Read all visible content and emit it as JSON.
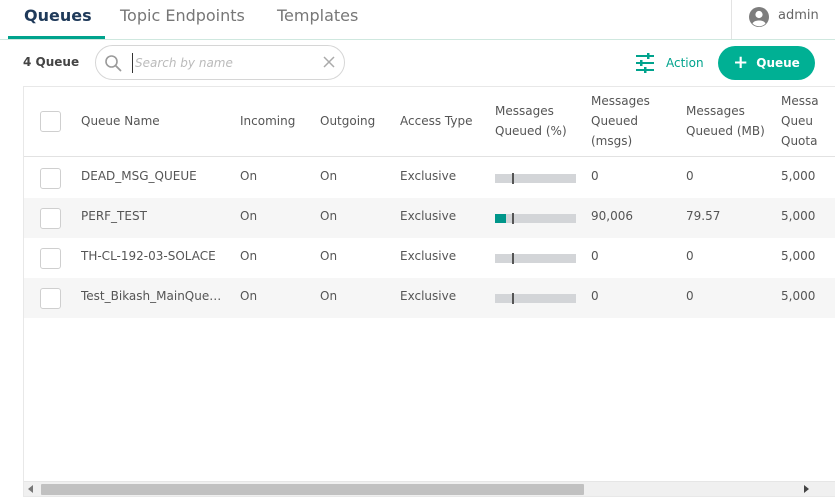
{
  "tabs": [
    {
      "label": "Queues",
      "active": true
    },
    {
      "label": "Topic Endpoints",
      "active": false
    },
    {
      "label": "Templates",
      "active": false
    }
  ],
  "user": {
    "name": "admin",
    "icon": "user-avatar-icon"
  },
  "toolbar": {
    "count_label": "4 Queue",
    "search_placeholder": "Search by name",
    "search_value": "",
    "action_label": "Action",
    "add_label": "Queue"
  },
  "colors": {
    "accent": "#00b094",
    "accent_dark": "#00968a",
    "tab_active_text": "#1f3a5a"
  },
  "table": {
    "columns": [
      {
        "line1": "Queue Name",
        "line2": "",
        "line3": ""
      },
      {
        "line1": "Incoming",
        "line2": "",
        "line3": ""
      },
      {
        "line1": "Outgoing",
        "line2": "",
        "line3": ""
      },
      {
        "line1": "Access Type",
        "line2": "",
        "line3": ""
      },
      {
        "line1": "Messages",
        "line2": "Queued (%)",
        "line3": ""
      },
      {
        "line1": "Messages",
        "line2": "Queued",
        "line3": "(msgs)"
      },
      {
        "line1": "Messages",
        "line2": "Queued (MB)",
        "line3": ""
      },
      {
        "line1": "Messa",
        "line2": "Queu",
        "line3": "Quota"
      }
    ],
    "rows": [
      {
        "name": "DEAD_MSG_QUEUE",
        "incoming": "On",
        "outgoing": "On",
        "access": "Exclusive",
        "queued_pct": 0,
        "queued_msgs": "0",
        "queued_mb": "0",
        "quota": "5,000"
      },
      {
        "name": "PERF_TEST",
        "incoming": "On",
        "outgoing": "On",
        "access": "Exclusive",
        "queued_pct": 0.14,
        "queued_msgs": "90,006",
        "queued_mb": "79.57",
        "quota": "5,000"
      },
      {
        "name": "TH-CL-192-03-SOLACE",
        "incoming": "On",
        "outgoing": "On",
        "access": "Exclusive",
        "queued_pct": 0,
        "queued_msgs": "0",
        "queued_mb": "0",
        "quota": "5,000"
      },
      {
        "name": "Test_Bikash_MainQue…",
        "incoming": "On",
        "outgoing": "On",
        "access": "Exclusive",
        "queued_pct": 0,
        "queued_msgs": "0",
        "queued_mb": "0",
        "quota": "5,000"
      }
    ]
  }
}
